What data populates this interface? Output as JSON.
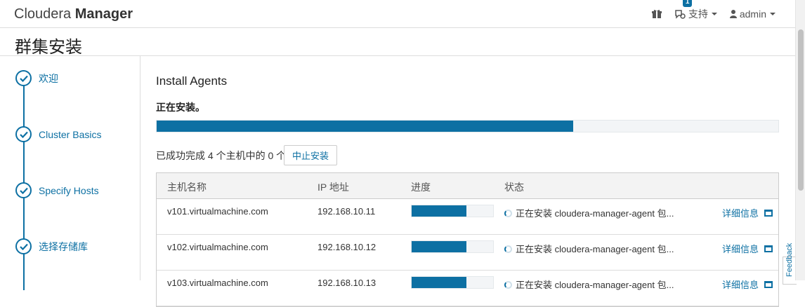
{
  "header": {
    "brand_light": "Cloudera",
    "brand_bold": "Manager",
    "support_badge": "1",
    "support_label": "支持",
    "user_label": "admin"
  },
  "page": {
    "title": "群集安装"
  },
  "wizard": {
    "steps": [
      {
        "label": "欢迎"
      },
      {
        "label": "Cluster Basics"
      },
      {
        "label": "Specify Hosts"
      },
      {
        "label": "选择存储库"
      }
    ]
  },
  "main": {
    "section_title": "Install Agents",
    "status": "正在安装。",
    "overall_progress": 0.67,
    "summary": "已成功完成 4 个主机中的 0 个。",
    "abort_label": "中止安装"
  },
  "table": {
    "headers": {
      "host": "主机名称",
      "ip": "IP 地址",
      "progress": "进度",
      "state": "状态"
    },
    "rows": [
      {
        "host": "v101.virtualmachine.com",
        "ip": "192.168.10.11",
        "progress": 0.67,
        "state": "正在安装 cloudera-manager-agent 包...",
        "detail": "详细信息"
      },
      {
        "host": "v102.virtualmachine.com",
        "ip": "192.168.10.12",
        "progress": 0.67,
        "state": "正在安装 cloudera-manager-agent 包...",
        "detail": "详细信息"
      },
      {
        "host": "v103.virtualmachine.com",
        "ip": "192.168.10.13",
        "progress": 0.67,
        "state": "正在安装 cloudera-manager-agent 包...",
        "detail": "详细信息"
      }
    ]
  },
  "feedback": {
    "label": "Feedback"
  },
  "colors": {
    "accent": "#0d70a3"
  }
}
